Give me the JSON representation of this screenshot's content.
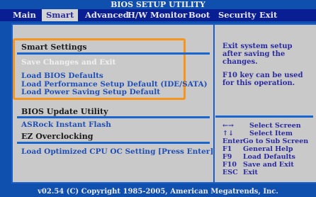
{
  "title": "BIOS SETUP UTILITY",
  "menu": [
    "Main",
    "Smart",
    "Advanced",
    "H/W Monitor",
    "Boot",
    "Security",
    "Exit"
  ],
  "smart_settings": {
    "header": "Smart Settings",
    "items": [
      "Save Changes and Exit",
      "Load BIOS Defaults",
      "Load Performance Setup Default (IDE/SATA)",
      "Load Power Saving Setup Default"
    ]
  },
  "bios_update": {
    "header": "BIOS Update Utility",
    "item": "ASRock Instant Flash"
  },
  "ez_overclocking": {
    "header": "EZ Overclocking",
    "item": "Load Optimized CPU OC Setting  [Press Enter]"
  },
  "help": {
    "line1": "Exit system setup",
    "line2": "after saving the",
    "line3": "changes.",
    "line4": "F10 key can be used",
    "line5": "for this operation."
  },
  "keys": [
    {
      "key": "←→",
      "desc": "Select Screen"
    },
    {
      "key": "↑↓",
      "desc": "Select Item"
    },
    {
      "key": "Enter",
      "desc": "Go to Sub Screen"
    },
    {
      "key": "F1",
      "desc": "General Help"
    },
    {
      "key": "F9",
      "desc": "Load Defaults"
    },
    {
      "key": "F10",
      "desc": "Save and Exit"
    },
    {
      "key": "ESC",
      "desc": "Exit"
    }
  ],
  "footer": "v02.54 (C) Copyright 1985-2005, American Megatrends, Inc."
}
